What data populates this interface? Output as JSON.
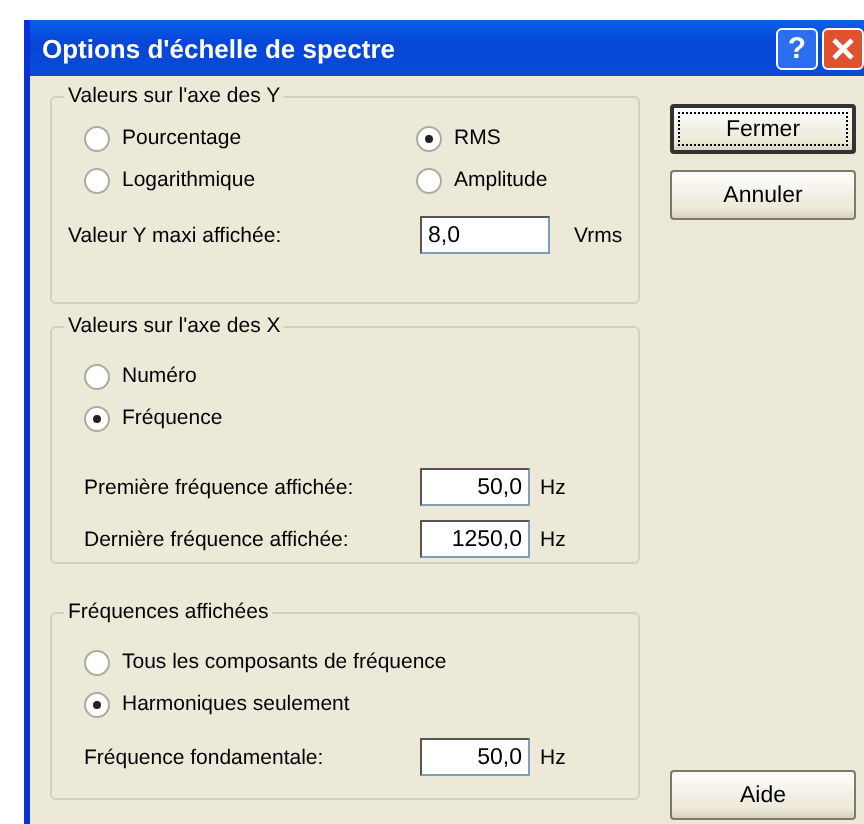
{
  "window": {
    "title": "Options d'échelle de spectre",
    "help_button": "?"
  },
  "y_axis": {
    "title": "Valeurs sur l'axe des Y",
    "options": [
      {
        "label": "Pourcentage",
        "selected": false
      },
      {
        "label": "RMS",
        "selected": true
      },
      {
        "label": "Logarithmique",
        "selected": false
      },
      {
        "label": "Amplitude",
        "selected": false
      }
    ],
    "fields": [
      {
        "label": "Valeur Y maxi affichée:",
        "value": "8,0",
        "unit": "Vrms"
      }
    ]
  },
  "x_axis": {
    "title": "Valeurs sur l'axe des X",
    "options": [
      {
        "label": "Numéro",
        "selected": false
      },
      {
        "label": "Fréquence",
        "selected": true
      }
    ],
    "fields": [
      {
        "label": "Première fréquence affichée:",
        "value": "50,0",
        "unit": "Hz"
      },
      {
        "label": "Dernière fréquence affichée:",
        "value": "1250,0",
        "unit": "Hz"
      }
    ]
  },
  "frequencies": {
    "title": "Fréquences affichées",
    "options": [
      {
        "label": "Tous les composants de fréquence",
        "selected": false
      },
      {
        "label": "Harmoniques seulement",
        "selected": true
      }
    ],
    "fields": [
      {
        "label": "Fréquence fondamentale:",
        "value": "50,0",
        "unit": "Hz"
      }
    ]
  },
  "buttons": [
    {
      "label": "Fermer",
      "default": true
    },
    {
      "label": "Annuler",
      "default": false
    },
    {
      "label": "Aide",
      "default": false
    }
  ]
}
